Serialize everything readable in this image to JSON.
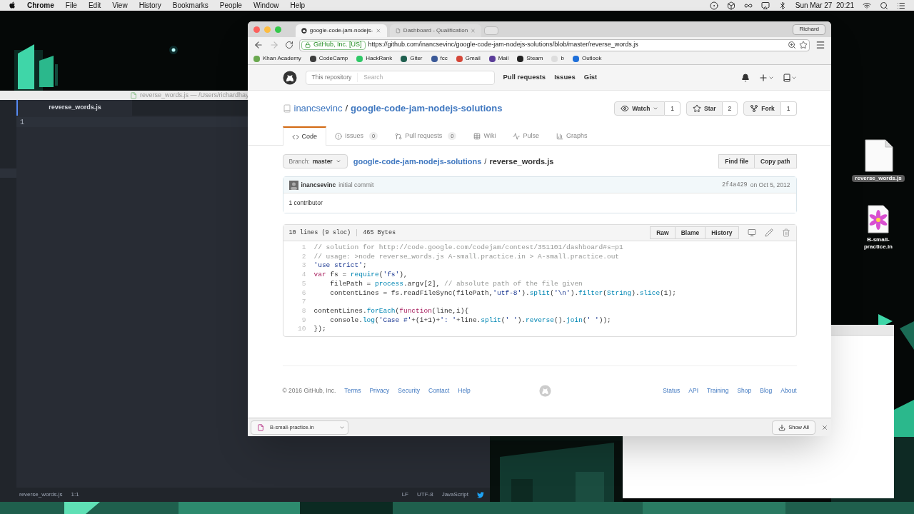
{
  "menubar": {
    "app": "Chrome",
    "menus": [
      "File",
      "Edit",
      "View",
      "History",
      "Bookmarks",
      "People",
      "Window",
      "Help"
    ],
    "clock": "Sun Mar 27  20:21"
  },
  "editor": {
    "title": "reverse_words.js — /Users/richardhay",
    "tab": "reverse_words.js",
    "line_numbers": [
      "1"
    ],
    "status": {
      "file": "reverse_words.js",
      "cursor": "1:1",
      "line_ending": "LF",
      "encoding": "UTF-8",
      "grammar": "JavaScript"
    }
  },
  "desktop_icons": [
    {
      "label": "reverse_words.js",
      "kind": "js",
      "selected": true
    },
    {
      "label": "B-small-practice.in",
      "kind": "flower",
      "selected": false
    }
  ],
  "browser": {
    "tabs": [
      {
        "title": "google-code-jam-nodejs-",
        "kind": "cat",
        "selected": true
      },
      {
        "title": "Dashboard - Qualification",
        "kind": "page",
        "selected": false
      }
    ],
    "profile": "Richard",
    "security_badge": "GitHub, Inc. [US]",
    "url": "https://github.com/inancsevinc/google-code-jam-nodejs-solutions/blob/master/reverse_words.js",
    "bookmarks": [
      {
        "label": "Khan Academy",
        "color": "#6aa84f"
      },
      {
        "label": "CodeCamp",
        "color": "#3d3d3d"
      },
      {
        "label": "HackRank",
        "color": "#2ec866"
      },
      {
        "label": "Giter",
        "color": "#1f5f4f"
      },
      {
        "label": "fcc",
        "color": "#3b5998"
      },
      {
        "label": "Gmail",
        "color": "#d44638"
      },
      {
        "label": "Mail",
        "color": "#5b3d99"
      },
      {
        "label": "Steam",
        "color": "#222222"
      },
      {
        "label": "b",
        "color": "#dddddd"
      },
      {
        "label": "Outlook",
        "color": "#1e6fd9"
      }
    ],
    "download": {
      "file": "B-small-practice.in",
      "show_all": "Show All"
    }
  },
  "github": {
    "search_scope": "This repository",
    "search_placeholder": "Search",
    "nav": [
      "Pull requests",
      "Issues",
      "Gist"
    ],
    "owner": "inancsevinc",
    "owner_separator": "/",
    "repo": "google-code-jam-nodejs-solutions",
    "actions": [
      {
        "label": "Watch",
        "count": "1",
        "kind": "watch"
      },
      {
        "label": "Star",
        "count": "2",
        "kind": "star"
      },
      {
        "label": "Fork",
        "count": "1",
        "kind": "fork"
      }
    ],
    "repo_tabs": [
      {
        "label": "Code",
        "kind": "code",
        "selected": true
      },
      {
        "label": "Issues",
        "count": "0",
        "kind": "issues",
        "selected": false
      },
      {
        "label": "Pull requests",
        "count": "0",
        "kind": "pulls",
        "selected": false
      },
      {
        "label": "Wiki",
        "kind": "wiki",
        "selected": false
      },
      {
        "label": "Pulse",
        "kind": "pulse",
        "selected": false
      },
      {
        "label": "Graphs",
        "kind": "graphs",
        "selected": false
      }
    ],
    "branch_label": "Branch:",
    "branch": "master",
    "path_repo": "google-code-jam-nodejs-solutions",
    "path_separator": "/",
    "path_file": "reverse_words.js",
    "path_buttons": [
      "Find file",
      "Copy path"
    ],
    "commit": {
      "author": "inancsevinc",
      "message": "initial commit",
      "sha": "2f4a429",
      "date": "on Oct 5, 2012"
    },
    "contributors": "1 contributor",
    "file": {
      "lines": "10 lines (9 sloc)",
      "size": "465 Bytes",
      "buttons": [
        "Raw",
        "Blame",
        "History"
      ],
      "code": [
        {
          "n": "1",
          "tokens": [
            {
              "kind": "comment",
              "text": "// solution for http://code.google.com/codejam/contest/351101/dashboard#s=p1"
            }
          ]
        },
        {
          "n": "2",
          "tokens": [
            {
              "kind": "comment",
              "text": "// usage: >node reverse_words.js A-small.practice.in > A-small.practice.out"
            }
          ]
        },
        {
          "n": "3",
          "tokens": [
            {
              "kind": "string",
              "text": "'use strict'"
            },
            {
              "kind": "plain",
              "text": ";"
            }
          ]
        },
        {
          "n": "4",
          "tokens": [
            {
              "kind": "keyword",
              "text": "var"
            },
            {
              "kind": "plain",
              "text": " fs = "
            },
            {
              "kind": "builtin",
              "text": "require"
            },
            {
              "kind": "plain",
              "text": "("
            },
            {
              "kind": "string",
              "text": "'fs'"
            },
            {
              "kind": "plain",
              "text": "),"
            }
          ]
        },
        {
          "n": "5",
          "tokens": [
            {
              "kind": "plain",
              "text": "    filePath = "
            },
            {
              "kind": "builtin",
              "text": "process"
            },
            {
              "kind": "plain",
              "text": ".argv[2], "
            },
            {
              "kind": "comment",
              "text": "// absolute path of the file given"
            }
          ]
        },
        {
          "n": "6",
          "tokens": [
            {
              "kind": "plain",
              "text": "    contentLines = fs.readFileSync(filePath,"
            },
            {
              "kind": "string",
              "text": "'utf-8'"
            },
            {
              "kind": "plain",
              "text": ")."
            },
            {
              "kind": "builtin",
              "text": "split"
            },
            {
              "kind": "plain",
              "text": "("
            },
            {
              "kind": "string",
              "text": "'\\n'"
            },
            {
              "kind": "plain",
              "text": ")."
            },
            {
              "kind": "builtin",
              "text": "filter"
            },
            {
              "kind": "plain",
              "text": "("
            },
            {
              "kind": "builtin",
              "text": "String"
            },
            {
              "kind": "plain",
              "text": ")."
            },
            {
              "kind": "builtin",
              "text": "slice"
            },
            {
              "kind": "plain",
              "text": "(1);"
            }
          ]
        },
        {
          "n": "7"
        },
        {
          "n": "8",
          "tokens": [
            {
              "kind": "plain",
              "text": "contentLines."
            },
            {
              "kind": "builtin",
              "text": "forEach"
            },
            {
              "kind": "plain",
              "text": "("
            },
            {
              "kind": "keyword",
              "text": "function"
            },
            {
              "kind": "plain",
              "text": "(line,i){"
            }
          ]
        },
        {
          "n": "9",
          "tokens": [
            {
              "kind": "plain",
              "text": "    console."
            },
            {
              "kind": "builtin",
              "text": "log"
            },
            {
              "kind": "plain",
              "text": "("
            },
            {
              "kind": "string",
              "text": "'Case #'"
            },
            {
              "kind": "plain",
              "text": "+(i+1)+"
            },
            {
              "kind": "string",
              "text": "': '"
            },
            {
              "kind": "plain",
              "text": "+line."
            },
            {
              "kind": "builtin",
              "text": "split"
            },
            {
              "kind": "plain",
              "text": "("
            },
            {
              "kind": "string",
              "text": "' '"
            },
            {
              "kind": "plain",
              "text": ")."
            },
            {
              "kind": "builtin",
              "text": "reverse"
            },
            {
              "kind": "plain",
              "text": "()."
            },
            {
              "kind": "builtin",
              "text": "join"
            },
            {
              "kind": "plain",
              "text": "("
            },
            {
              "kind": "string",
              "text": "' '"
            },
            {
              "kind": "plain",
              "text": "));"
            }
          ]
        },
        {
          "n": "10",
          "tokens": [
            {
              "kind": "plain",
              "text": "});"
            }
          ]
        }
      ]
    },
    "footer": {
      "copyright": "© 2016 GitHub, Inc.",
      "left_links": [
        "Terms",
        "Privacy",
        "Security",
        "Contact",
        "Help"
      ],
      "right_links": [
        "Status",
        "API",
        "Training",
        "Shop",
        "Blog",
        "About"
      ]
    }
  }
}
